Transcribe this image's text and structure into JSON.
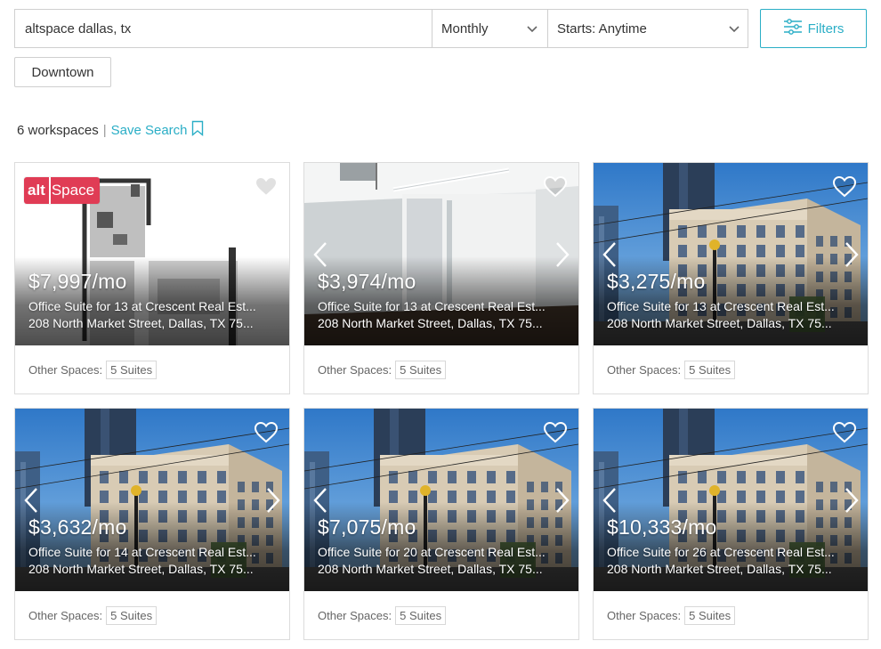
{
  "search": {
    "query": "altspace dallas, tx",
    "term": "Monthly",
    "starts": "Starts: Anytime",
    "filters_label": "Filters"
  },
  "chip": {
    "label": "Downtown"
  },
  "results": {
    "count_text": "6 workspaces",
    "separator": "|",
    "save_label": "Save Search"
  },
  "icons": {
    "filters": "sliders-icon",
    "save": "bookmark-icon",
    "heart": "heart-icon",
    "prev": "chevron-left-icon",
    "next": "chevron-right-icon",
    "dropdown": "chevron-down-icon"
  },
  "colors": {
    "accent": "#2aaec6",
    "brand": "#e03c55"
  },
  "brand_badge": {
    "part1": "alt",
    "part2": "Space"
  },
  "cards": [
    {
      "price": "$7,997/mo",
      "title": "Office Suite for 13 at Crescent Real Est...",
      "address": "208 North Market Street, Dallas, TX 75...",
      "other_label": "Other Spaces:",
      "suites": "5 Suites",
      "image": "floorplan"
    },
    {
      "price": "$3,974/mo",
      "title": "Office Suite for 13 at Crescent Real Est...",
      "address": "208 North Market Street, Dallas, TX 75...",
      "other_label": "Other Spaces:",
      "suites": "5 Suites",
      "image": "interior"
    },
    {
      "price": "$3,275/mo",
      "title": "Office Suite for 13 at Crescent Real Est...",
      "address": "208 North Market Street, Dallas, TX 75...",
      "other_label": "Other Spaces:",
      "suites": "5 Suites",
      "image": "building"
    },
    {
      "price": "$3,632/mo",
      "title": "Office Suite for 14 at Crescent Real Est...",
      "address": "208 North Market Street, Dallas, TX 75...",
      "other_label": "Other Spaces:",
      "suites": "5 Suites",
      "image": "building"
    },
    {
      "price": "$7,075/mo",
      "title": "Office Suite for 20 at Crescent Real Est...",
      "address": "208 North Market Street, Dallas, TX 75...",
      "other_label": "Other Spaces:",
      "suites": "5 Suites",
      "image": "building"
    },
    {
      "price": "$10,333/mo",
      "title": "Office Suite for 26 at Crescent Real Est...",
      "address": "208 North Market Street, Dallas, TX 75...",
      "other_label": "Other Spaces:",
      "suites": "5 Suites",
      "image": "building"
    }
  ]
}
